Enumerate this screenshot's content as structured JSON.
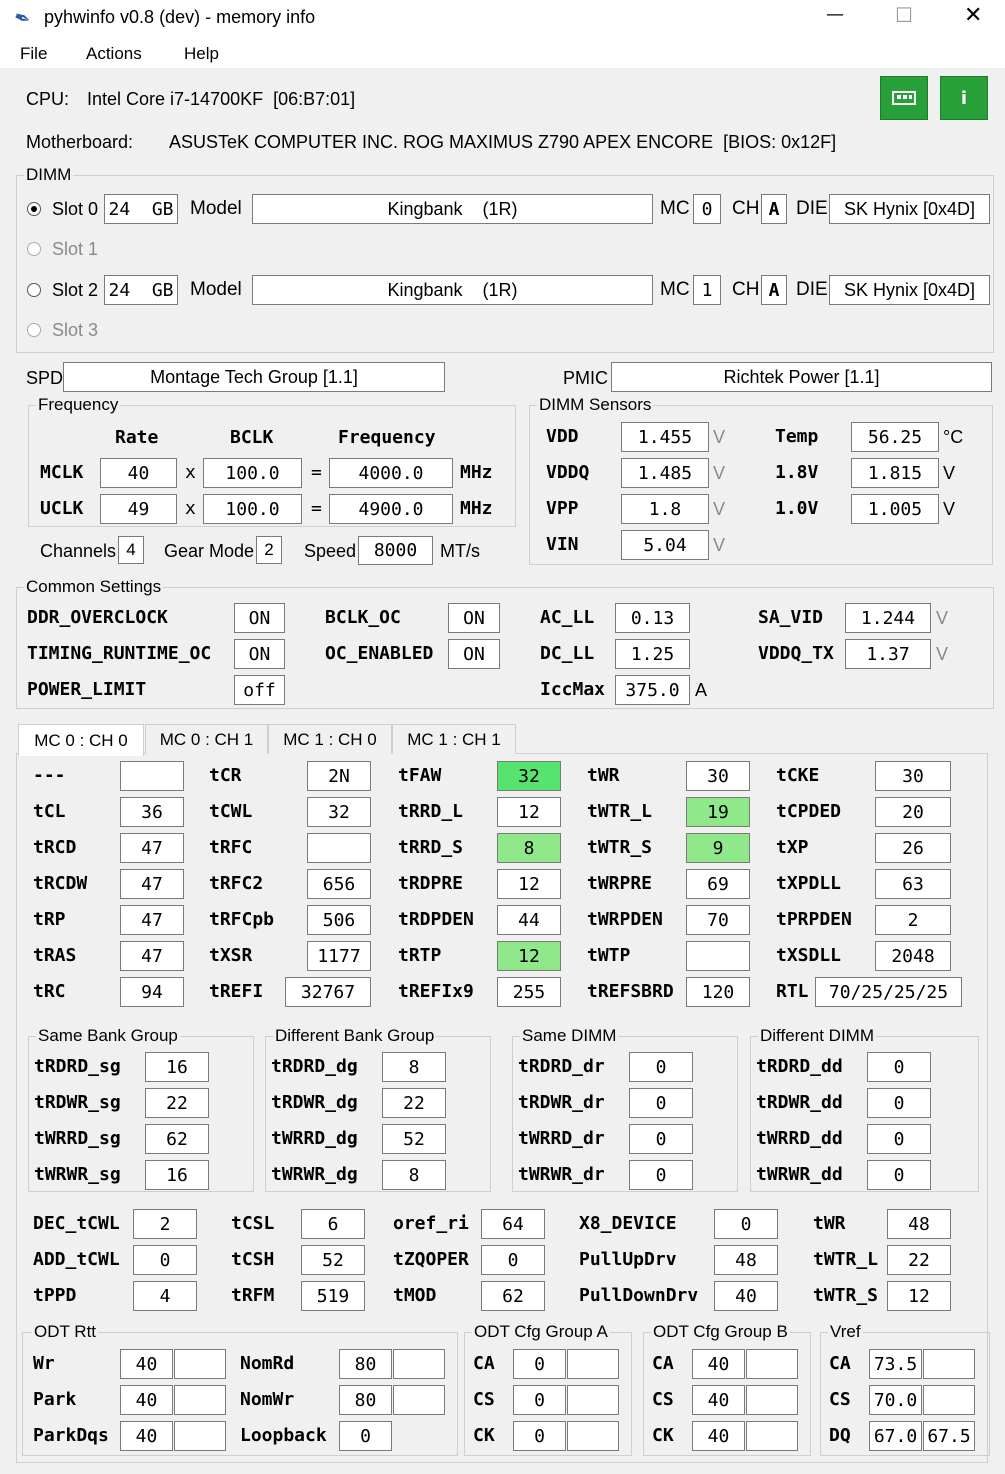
{
  "window": {
    "title": "pyhwinfo v0.8 (dev) - memory info",
    "minimize": "—",
    "maximize": "☐",
    "close": "✕"
  },
  "menu": [
    "File",
    "Actions",
    "Help"
  ],
  "cpu": {
    "label": "CPU:",
    "value": "Intel Core i7-14700KF  [06:B7:01]"
  },
  "motherboard": {
    "label": "Motherboard:",
    "value": "ASUSTeK COMPUTER INC. ROG MAXIMUS Z790 APEX ENCORE  [BIOS: 0x12F]"
  },
  "buttons": {
    "memory_icon": "memory-icon",
    "info": "i"
  },
  "dimm": {
    "title": "DIMM",
    "col_model": "Model",
    "col_mc": "MC",
    "col_ch": "CH",
    "col_die": "DIE",
    "slots": [
      {
        "label": "Slot 0",
        "size": "24  GB",
        "model": "Kingbank    (1R)",
        "mc": "0",
        "ch": "A",
        "die": "SK Hynix [0x4D]"
      },
      {
        "label": "Slot 1"
      },
      {
        "label": "Slot 2",
        "size": "24  GB",
        "model": "Kingbank    (1R)",
        "mc": "1",
        "ch": "A",
        "die": "SK Hynix [0x4D]"
      },
      {
        "label": "Slot 3"
      }
    ]
  },
  "spd": {
    "label": "SPD",
    "value": "Montage Tech Group [1.1]"
  },
  "pmic": {
    "label": "PMIC",
    "value": "Richtek Power [1.1]"
  },
  "frequency": {
    "title": "Frequency",
    "h_rate": "Rate",
    "h_bclk": "BCLK",
    "h_freq": "Frequency",
    "rows": [
      {
        "name": "MCLK",
        "rate": "40",
        "bclk": "100.0",
        "freq": "4000.0",
        "unit": "MHz"
      },
      {
        "name": "UCLK",
        "rate": "49",
        "bclk": "100.0",
        "freq": "4900.0",
        "unit": "MHz"
      }
    ],
    "x": "x",
    "eq": "=",
    "channels_label": "Channels",
    "channels": "4",
    "gear_label": "Gear Mode",
    "gear": "2",
    "speed_label": "Speed",
    "speed": "8000",
    "speed_unit": "MT/s"
  },
  "sensors": {
    "title": "DIMM Sensors",
    "rows": [
      {
        "l": "VDD",
        "v": "1.455",
        "u": "V",
        "l2": "Temp",
        "v2": "56.25",
        "u2": "°C"
      },
      {
        "l": "VDDQ",
        "v": "1.485",
        "u": "V",
        "l2": "1.8V",
        "v2": "1.815",
        "u2": "V"
      },
      {
        "l": "VPP",
        "v": "1.8",
        "u": "V",
        "l2": "1.0V",
        "v2": "1.005",
        "u2": "V"
      },
      {
        "l": "VIN",
        "v": "5.04",
        "u": "V"
      }
    ]
  },
  "common": {
    "title": "Common Settings",
    "items": [
      {
        "l": "DDR_OVERCLOCK",
        "v": "ON"
      },
      {
        "l": "TIMING_RUNTIME_OC",
        "v": "ON"
      },
      {
        "l": "POWER_LIMIT",
        "v": "off"
      },
      {
        "l": "BCLK_OC",
        "v": "ON"
      },
      {
        "l": "OC_ENABLED",
        "v": "ON"
      },
      {
        "l": "AC_LL",
        "v": "0.13"
      },
      {
        "l": "DC_LL",
        "v": "1.25"
      },
      {
        "l": "IccMax",
        "v": "375.0",
        "u": "A"
      },
      {
        "l": "SA_VID",
        "v": "1.244",
        "u": "V"
      },
      {
        "l": "VDDQ_TX",
        "v": "1.37",
        "u": "V"
      }
    ]
  },
  "tabs": [
    "MC 0 : CH 0",
    "MC 0 : CH 1",
    "MC 1 : CH 0",
    "MC 1 : CH 1"
  ],
  "timings": [
    [
      {
        "l": "---",
        "v": ""
      },
      {
        "l": "tCL",
        "v": "36"
      },
      {
        "l": "tRCD",
        "v": "47"
      },
      {
        "l": "tRCDW",
        "v": "47"
      },
      {
        "l": "tRP",
        "v": "47"
      },
      {
        "l": "tRAS",
        "v": "47"
      },
      {
        "l": "tRC",
        "v": "94"
      }
    ],
    [
      {
        "l": "tCR",
        "v": "2N"
      },
      {
        "l": "tCWL",
        "v": "32"
      },
      {
        "l": "tRFC",
        "v": ""
      },
      {
        "l": "tRFC2",
        "v": "656"
      },
      {
        "l": "tRFCpb",
        "v": "506"
      },
      {
        "l": "tXSR",
        "v": "1177"
      },
      {
        "l": "tREFI",
        "v": "32767"
      }
    ],
    [
      {
        "l": "tFAW",
        "v": "32",
        "hl": "g"
      },
      {
        "l": "tRRD_L",
        "v": "12"
      },
      {
        "l": "tRRD_S",
        "v": "8",
        "hl": "g2"
      },
      {
        "l": "tRDPRE",
        "v": "12"
      },
      {
        "l": "tRDPDEN",
        "v": "44"
      },
      {
        "l": "tRTP",
        "v": "12",
        "hl": "g2"
      },
      {
        "l": "tREFIx9",
        "v": "255"
      }
    ],
    [
      {
        "l": "tWR",
        "v": "30"
      },
      {
        "l": "tWTR_L",
        "v": "19",
        "hl": "g2"
      },
      {
        "l": "tWTR_S",
        "v": "9",
        "hl": "g2"
      },
      {
        "l": "tWRPRE",
        "v": "69"
      },
      {
        "l": "tWRPDEN",
        "v": "70"
      },
      {
        "l": "tWTP",
        "v": ""
      },
      {
        "l": "tREFSBRD",
        "v": "120"
      }
    ],
    [
      {
        "l": "tCKE",
        "v": "30"
      },
      {
        "l": "tCPDED",
        "v": "20"
      },
      {
        "l": "tXP",
        "v": "26"
      },
      {
        "l": "tXPDLL",
        "v": "63"
      },
      {
        "l": "tPRPDEN",
        "v": "2"
      },
      {
        "l": "tXSDLL",
        "v": "2048"
      },
      {
        "l": "RTL",
        "v": "70/25/25/25"
      }
    ]
  ],
  "bankgroups": [
    {
      "title": "Same Bank Group",
      "rows": [
        {
          "l": "tRDRD_sg",
          "v": "16"
        },
        {
          "l": "tRDWR_sg",
          "v": "22"
        },
        {
          "l": "tWRRD_sg",
          "v": "62"
        },
        {
          "l": "tWRWR_sg",
          "v": "16"
        }
      ]
    },
    {
      "title": "Different Bank Group",
      "rows": [
        {
          "l": "tRDRD_dg",
          "v": "8"
        },
        {
          "l": "tRDWR_dg",
          "v": "22"
        },
        {
          "l": "tWRRD_dg",
          "v": "52"
        },
        {
          "l": "tWRWR_dg",
          "v": "8"
        }
      ]
    },
    {
      "title": "Same DIMM",
      "rows": [
        {
          "l": "tRDRD_dr",
          "v": "0"
        },
        {
          "l": "tRDWR_dr",
          "v": "0"
        },
        {
          "l": "tWRRD_dr",
          "v": "0"
        },
        {
          "l": "tWRWR_dr",
          "v": "0"
        }
      ]
    },
    {
      "title": "Different DIMM",
      "rows": [
        {
          "l": "tRDRD_dd",
          "v": "0"
        },
        {
          "l": "tRDWR_dd",
          "v": "0"
        },
        {
          "l": "tWRRD_dd",
          "v": "0"
        },
        {
          "l": "tWRWR_dd",
          "v": "0"
        }
      ]
    }
  ],
  "misc": [
    [
      {
        "l": "DEC_tCWL",
        "v": "2"
      },
      {
        "l": "ADD_tCWL",
        "v": "0"
      },
      {
        "l": "tPPD",
        "v": "4"
      }
    ],
    [
      {
        "l": "tCSL",
        "v": "6"
      },
      {
        "l": "tCSH",
        "v": "52"
      },
      {
        "l": "tRFM",
        "v": "519"
      }
    ],
    [
      {
        "l": "oref_ri",
        "v": "64"
      },
      {
        "l": "tZQOPER",
        "v": "0"
      },
      {
        "l": "tMOD",
        "v": "62"
      }
    ],
    [
      {
        "l": "X8_DEVICE",
        "v": "0"
      },
      {
        "l": "PullUpDrv",
        "v": "48"
      },
      {
        "l": "PullDownDrv",
        "v": "40"
      }
    ],
    [
      {
        "l": "tWR",
        "v": "48"
      },
      {
        "l": "tWTR_L",
        "v": "22"
      },
      {
        "l": "tWTR_S",
        "v": "12"
      }
    ]
  ],
  "odt": {
    "title": "ODT Rtt",
    "rows": [
      {
        "l": "Wr",
        "v": "40",
        "v2": ""
      },
      {
        "l": "Park",
        "v": "40",
        "v2": ""
      },
      {
        "l": "ParkDqs",
        "v": "40",
        "v2": ""
      }
    ],
    "rows2": [
      {
        "l": "NomRd",
        "v": "80",
        "v2": ""
      },
      {
        "l": "NomWr",
        "v": "80",
        "v2": ""
      },
      {
        "l": "Loopback",
        "v": "0"
      }
    ]
  },
  "odt_a": {
    "title": "ODT Cfg Group A",
    "rows": [
      {
        "l": "CA",
        "v": "0",
        "v2": ""
      },
      {
        "l": "CS",
        "v": "0",
        "v2": ""
      },
      {
        "l": "CK",
        "v": "0",
        "v2": ""
      }
    ]
  },
  "odt_b": {
    "title": "ODT Cfg Group B",
    "rows": [
      {
        "l": "CA",
        "v": "40",
        "v2": ""
      },
      {
        "l": "CS",
        "v": "40",
        "v2": ""
      },
      {
        "l": "CK",
        "v": "40",
        "v2": ""
      }
    ]
  },
  "vref": {
    "title": "Vref",
    "rows": [
      {
        "l": "CA",
        "v": "73.5",
        "v2": ""
      },
      {
        "l": "CS",
        "v": "70.0",
        "v2": ""
      },
      {
        "l": "DQ",
        "v": "67.0",
        "v2": "67.5"
      }
    ]
  }
}
